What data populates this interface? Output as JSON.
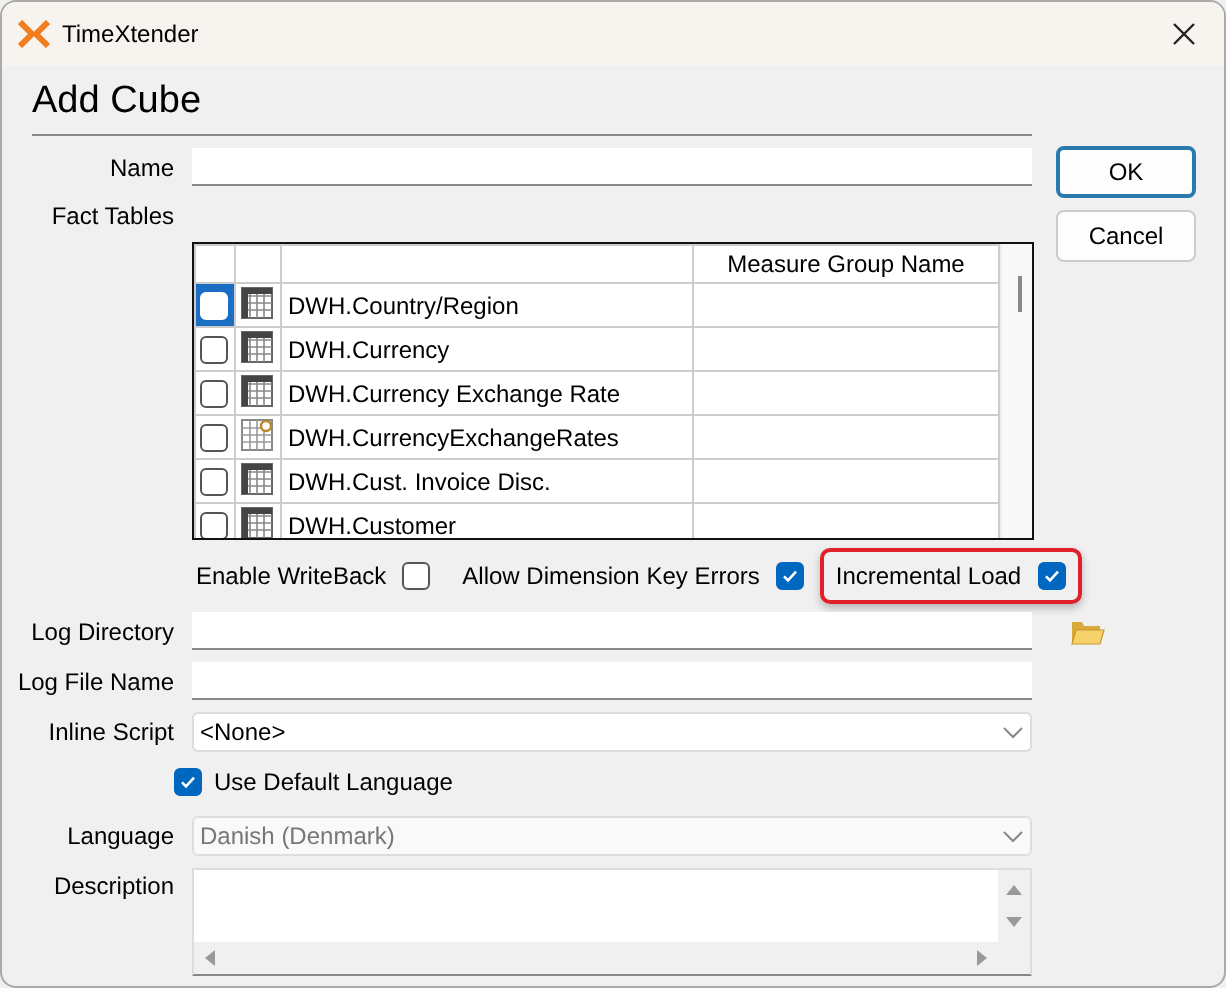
{
  "window": {
    "title": "TimeXtender"
  },
  "heading": "Add Cube",
  "buttons": [
    {
      "label": "OK",
      "default": true
    },
    {
      "label": "Cancel",
      "default": false
    }
  ],
  "name_field": {
    "label": "Name"
  },
  "fact_tables": {
    "label": "Fact Tables",
    "columns": [
      "Measure Group Name"
    ],
    "rows": [
      {
        "name": "DWH.Country/Region",
        "kind": "table",
        "checked": false,
        "selected": true
      },
      {
        "name": "DWH.Currency",
        "kind": "table",
        "checked": false,
        "selected": false
      },
      {
        "name": "DWH.Currency Exchange Rate",
        "kind": "table",
        "checked": false,
        "selected": false
      },
      {
        "name": "DWH.CurrencyExchangeRates",
        "kind": "query",
        "checked": false,
        "selected": false
      },
      {
        "name": "DWH.Cust. Invoice Disc.",
        "kind": "table",
        "checked": false,
        "selected": false
      },
      {
        "name": "DWH.Customer",
        "kind": "table",
        "checked": false,
        "selected": false
      }
    ]
  },
  "options": [
    {
      "label": "Enable WriteBack",
      "checked": false,
      "highlighted": false
    },
    {
      "label": "Allow Dimension Key Errors",
      "checked": true,
      "highlighted": false
    },
    {
      "label": "Incremental Load",
      "checked": true,
      "highlighted": true
    }
  ],
  "log_directory": {
    "label": "Log Directory"
  },
  "log_file_name": {
    "label": "Log File Name"
  },
  "inline_script": {
    "label": "Inline Script",
    "value": "<None>",
    "disabled": false
  },
  "use_default_language": {
    "label": "Use Default Language",
    "checked": true
  },
  "language": {
    "label": "Language",
    "value": "Danish (Denmark)",
    "disabled": true
  },
  "description": {
    "label": "Description"
  }
}
